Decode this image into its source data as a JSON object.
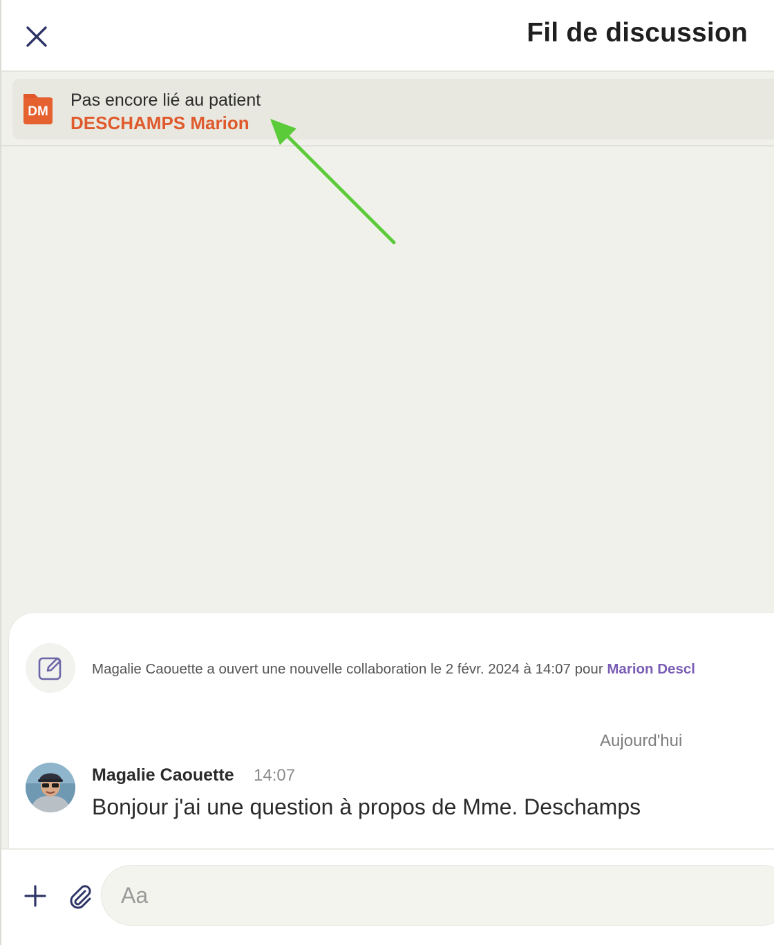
{
  "header": {
    "title": "Fil de discussion",
    "close_icon": "close-icon"
  },
  "patient_banner": {
    "initials": "DM",
    "status": "Pas encore lié au patient",
    "name": "DESCHAMPS Marion",
    "folder_color": "#e0572a",
    "name_color": "#df5a2c"
  },
  "annotation": {
    "arrow_color": "#5ccb3a",
    "arrow_icon": "arrow-annotation"
  },
  "thread": {
    "event": {
      "icon": "edit-note-icon",
      "text": "Magalie Caouette a ouvert une nouvelle collaboration le 2 févr. 2024 à 14:07 pour ",
      "link": "Marion Descl"
    },
    "date_separator": "Aujourd'hui",
    "messages": [
      {
        "author": "Magalie Caouette",
        "time": "14:07",
        "text": "Bonjour j'ai une question à propos de Mme. Deschamps"
      }
    ]
  },
  "composer": {
    "placeholder": "Aa",
    "plus_icon": "plus-icon",
    "attach_icon": "paperclip-icon"
  },
  "colors": {
    "accent_purple": "#7a5db5",
    "icon_navy": "#2e3566",
    "background": "#f1f1ec"
  }
}
